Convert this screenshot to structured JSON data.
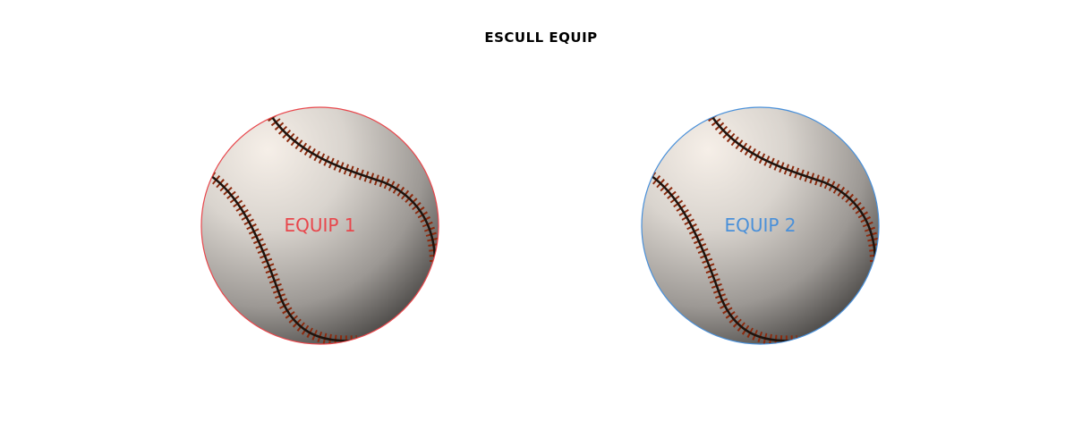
{
  "header": {
    "title": "ESCULL EQUIP"
  },
  "teams": [
    {
      "label": "EQUIP 1",
      "color": "#e8474c"
    },
    {
      "label": "EQUIP 2",
      "color": "#4a90d9"
    }
  ],
  "icons": {
    "team_ball": "baseball-icon"
  }
}
